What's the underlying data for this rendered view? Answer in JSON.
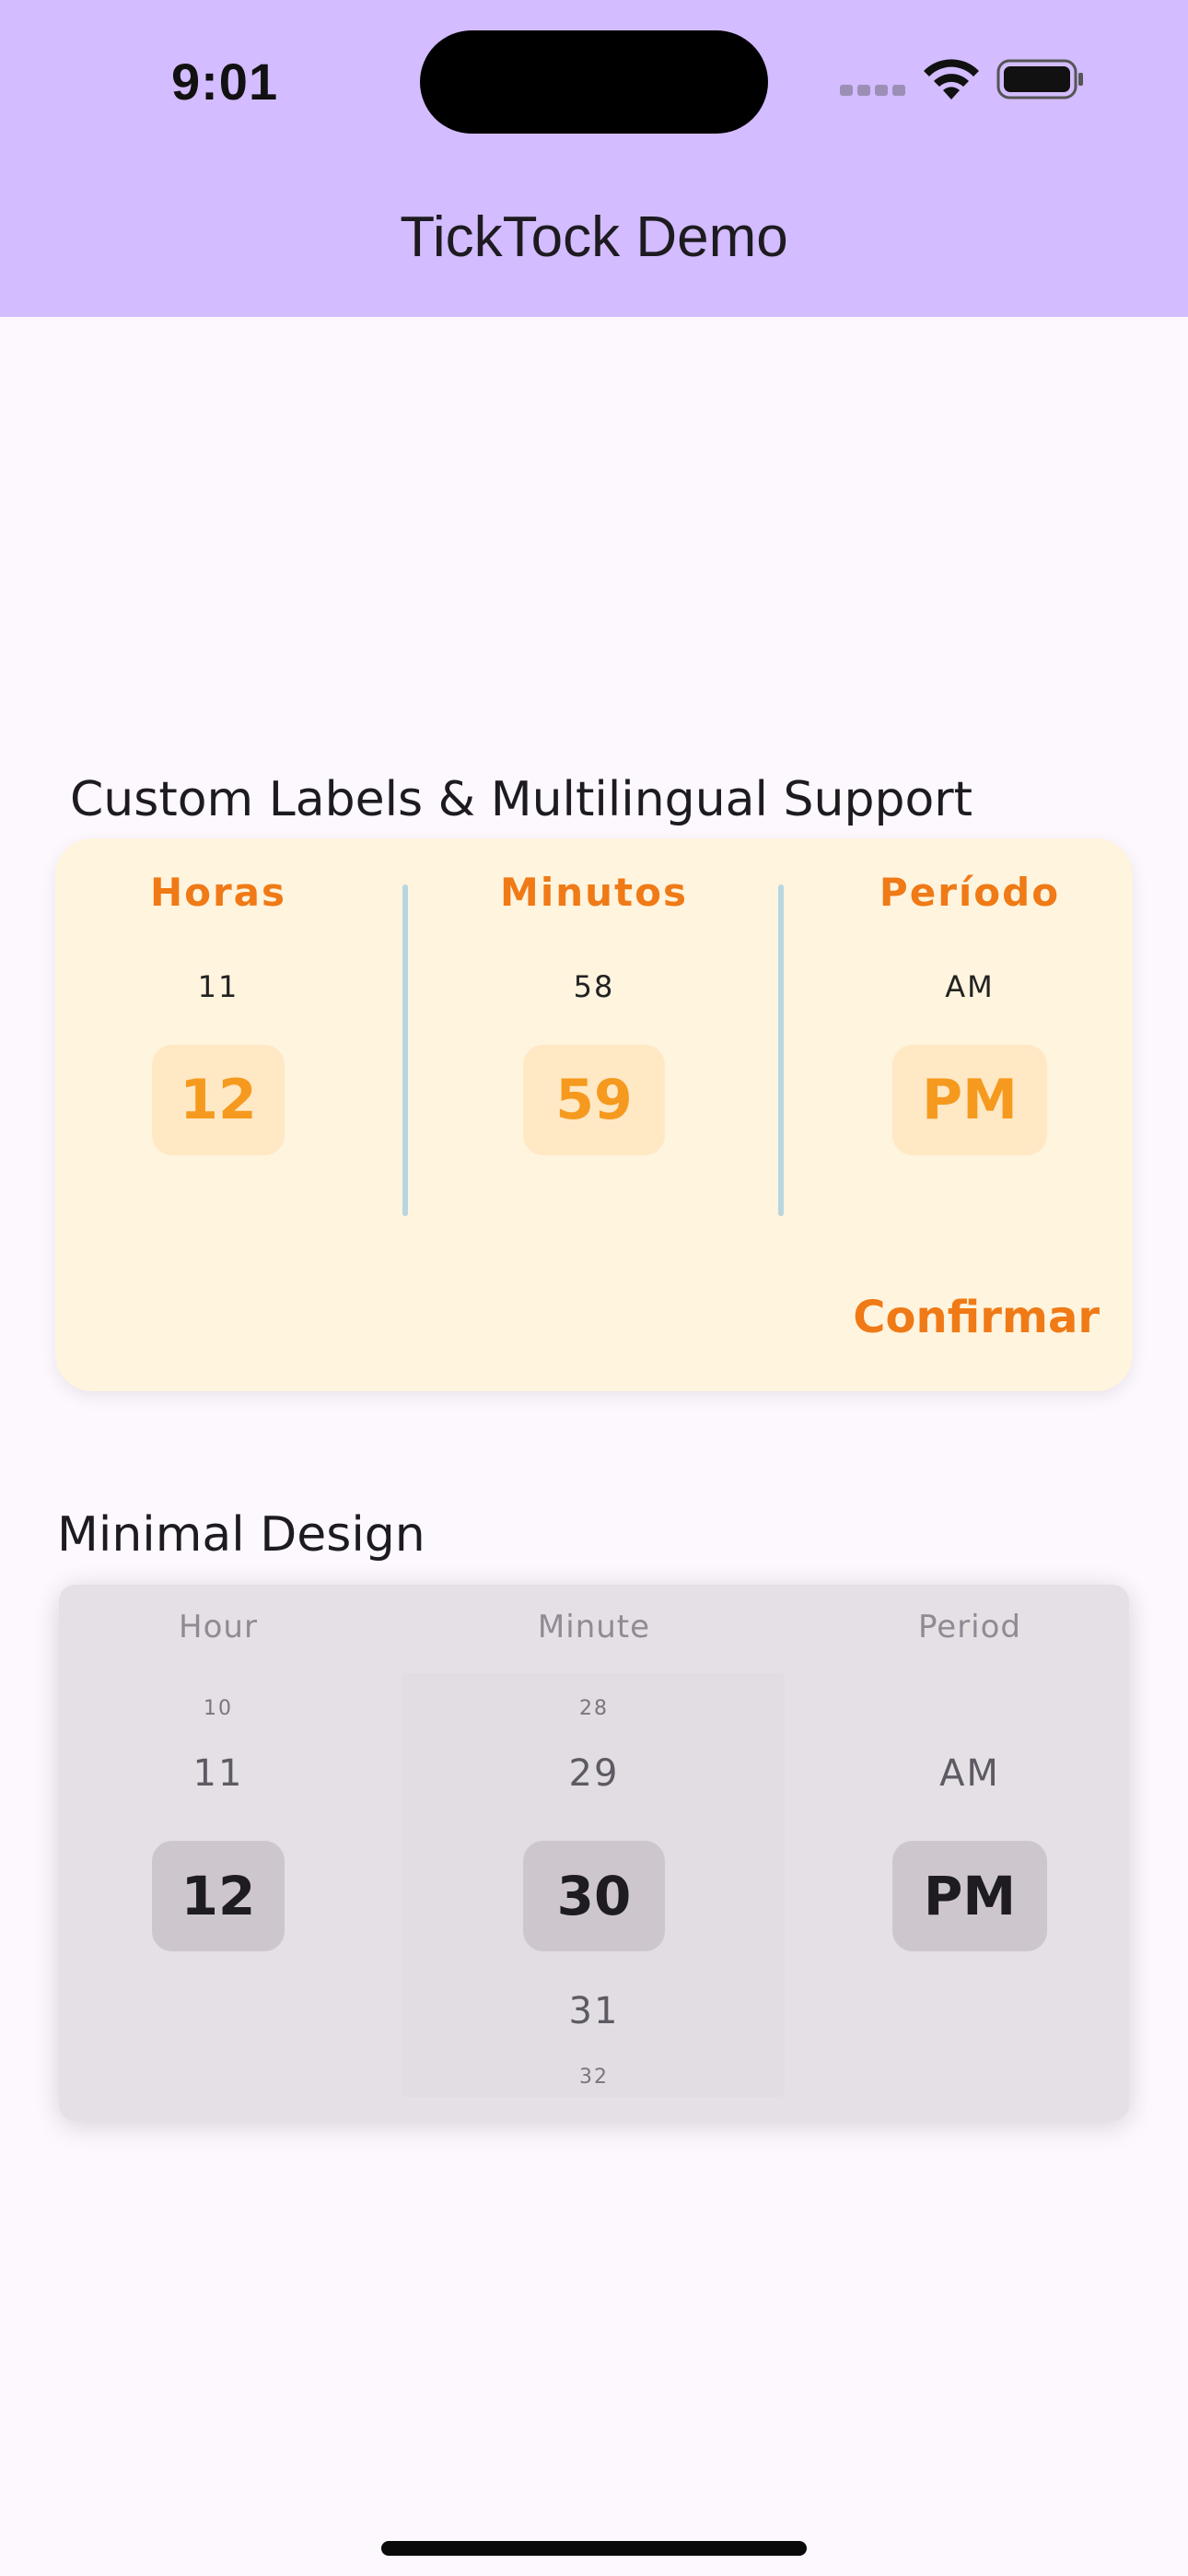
{
  "status_bar": {
    "time": "9:01"
  },
  "app_bar": {
    "title": "TickTock Demo"
  },
  "sections": {
    "custom": {
      "title": "Custom Labels & Multilingual Support",
      "labels": [
        "Horas",
        "Minutos",
        "Período"
      ],
      "hour": {
        "prev": "11",
        "selected": "12"
      },
      "minute": {
        "prev": "58",
        "selected": "59"
      },
      "period": {
        "prev": "AM",
        "selected": "PM"
      },
      "confirm_label": "Confirmar",
      "accent_color": "#ef7a16",
      "background_color": "#fff4de"
    },
    "minimal": {
      "title": "Minimal Design",
      "labels": [
        "Hour",
        "Minute",
        "Period"
      ],
      "hour": {
        "prev2": "10",
        "prev": "11",
        "selected": "12"
      },
      "minute": {
        "prev2": "28",
        "prev": "29",
        "selected": "30",
        "next": "31",
        "next2": "32"
      },
      "period": {
        "prev": "AM",
        "selected": "PM"
      },
      "background_color": "#e4e0e5"
    }
  }
}
